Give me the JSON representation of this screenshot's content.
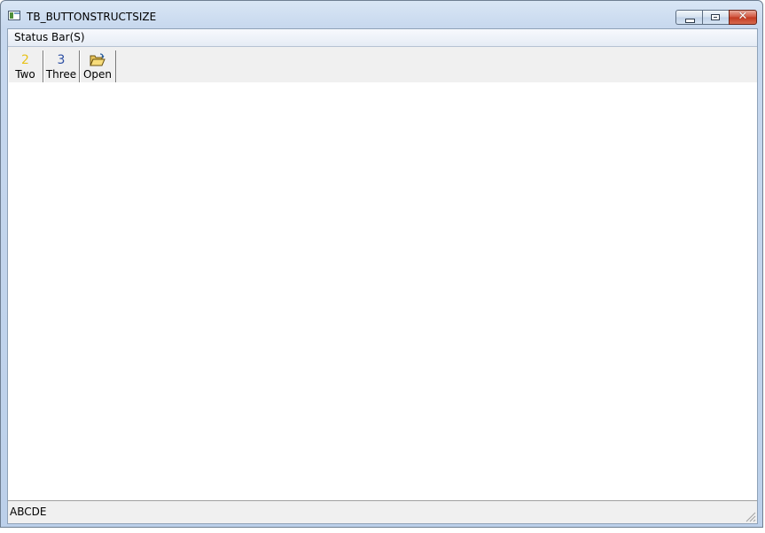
{
  "window": {
    "title": "TB_BUTTONSTRUCTSIZE",
    "icon": "application-window-icon",
    "controls": {
      "minimize_icon": "minimize-icon",
      "restore_icon": "restore-icon",
      "close_icon": "close-icon",
      "close_glyph": "✕"
    }
  },
  "menu": {
    "items": [
      {
        "label": "Status Bar(S)"
      }
    ]
  },
  "toolbar": {
    "buttons": [
      {
        "label": "Two",
        "glyph": "2",
        "glyph_color": "#e8c21a",
        "icon": "number-two-icon"
      },
      {
        "label": "Three",
        "glyph": "3",
        "glyph_color": "#2d4fa3",
        "icon": "number-three-icon"
      },
      {
        "label": "Open",
        "glyph": "📂",
        "glyph_color": "#c9a227",
        "icon": "open-folder-icon"
      }
    ]
  },
  "statusbar": {
    "text": "ABCDE",
    "grip_icon": "size-grip-icon"
  },
  "colors": {
    "title_gradient_top": "#d9e6f5",
    "close_button": "#c23a22",
    "client_background": "#ffffff",
    "chrome_background": "#f0f0f0"
  }
}
